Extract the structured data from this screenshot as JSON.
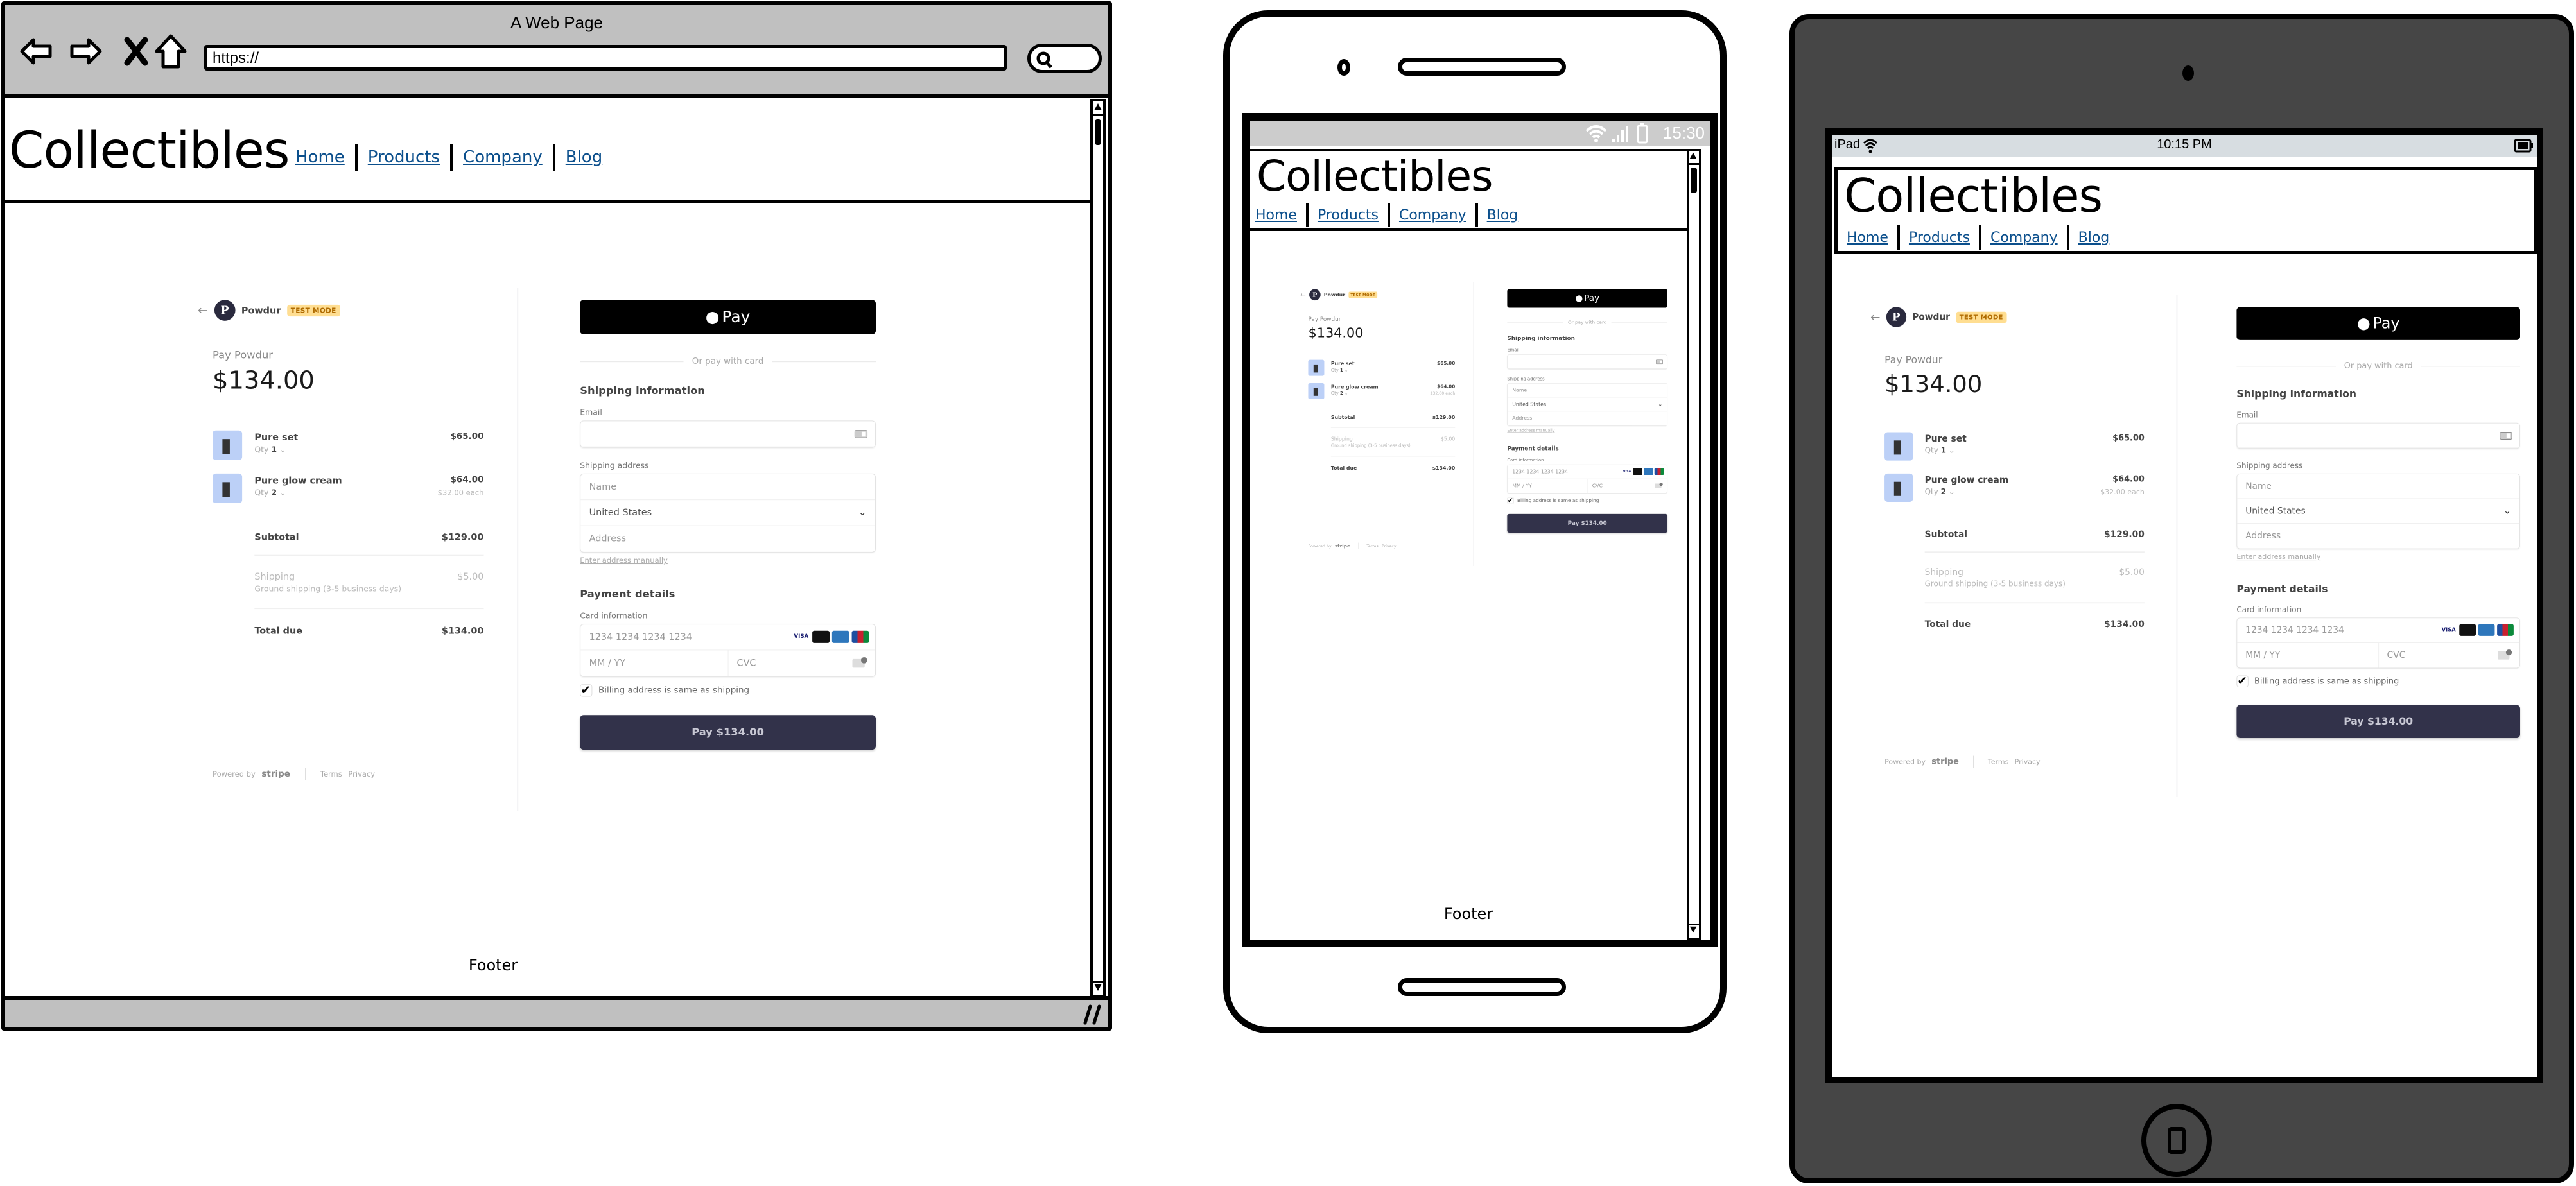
{
  "browser": {
    "window_title": "A Web Page",
    "url": "https://",
    "nav_icons": [
      "back-arrow-icon",
      "forward-arrow-icon",
      "close-x-icon",
      "home-icon"
    ],
    "search_icon": "search-icon"
  },
  "site": {
    "brand": "Collectibles",
    "nav": [
      {
        "label": "Home"
      },
      {
        "label": "Products"
      },
      {
        "label": "Company"
      },
      {
        "label": "Blog"
      }
    ],
    "footer": "Footer",
    "link_color": "#0b4f8c"
  },
  "phone": {
    "status_time": "15:30",
    "status_icons": [
      "wifi-icon",
      "signal-icon",
      "battery-icon"
    ]
  },
  "tablet": {
    "device_label": "iPad",
    "status_time": "10:15 PM",
    "status_icons": [
      "wifi-icon",
      "battery-icon"
    ]
  },
  "checkout": {
    "merchant": {
      "back_icon": "back-arrow-icon",
      "logo_letter": "P",
      "name": "Powdur",
      "badge": "TEST MODE"
    },
    "pay_label": "Pay Powdur",
    "pay_amount": "$134.00",
    "items": [
      {
        "name": "Pure set",
        "qty_label": "Qty",
        "qty": "1",
        "price": "$65.00",
        "each": ""
      },
      {
        "name": "Pure glow cream",
        "qty_label": "Qty",
        "qty": "2",
        "price": "$64.00",
        "each": "$32.00 each"
      }
    ],
    "subtotal": {
      "label": "Subtotal",
      "value": "$129.00"
    },
    "shipping": {
      "label": "Shipping",
      "detail": "Ground shipping (3-5 business days)",
      "value": "$5.00"
    },
    "total": {
      "label": "Total due",
      "value": "$134.00"
    },
    "powered_by": {
      "prefix": "Powered by",
      "brand": "stripe",
      "terms": "Terms",
      "privacy": "Privacy"
    },
    "apple_pay": {
      "symbol": "",
      "label": "Pay"
    },
    "or_pay_with_card": "Or pay with card",
    "shipping_info": {
      "title": "Shipping information",
      "email_label": "Email",
      "email_value": "",
      "address_label": "Shipping address",
      "name_placeholder": "Name",
      "country_selected": "United States",
      "address_placeholder": "Address",
      "enter_manually": "Enter address manually"
    },
    "payment": {
      "title": "Payment details",
      "card_label": "Card information",
      "card_placeholder": "1234 1234 1234 1234",
      "expiry_placeholder": "MM / YY",
      "cvc_placeholder": "CVC",
      "card_brands": [
        {
          "name": "visa",
          "color": "#1a1f71"
        },
        {
          "name": "mastercard",
          "color": "#eb001b"
        },
        {
          "name": "amex",
          "color": "#2e77bc"
        },
        {
          "name": "jcb",
          "color": "#0b8a3b"
        }
      ],
      "billing_same": "Billing address is same as shipping",
      "billing_same_checked": true,
      "pay_button": "Pay $134.00"
    },
    "colors": {
      "pay_button": "#32324a",
      "badge_bg": "#ffde92",
      "apple_pay": "#000000"
    }
  }
}
